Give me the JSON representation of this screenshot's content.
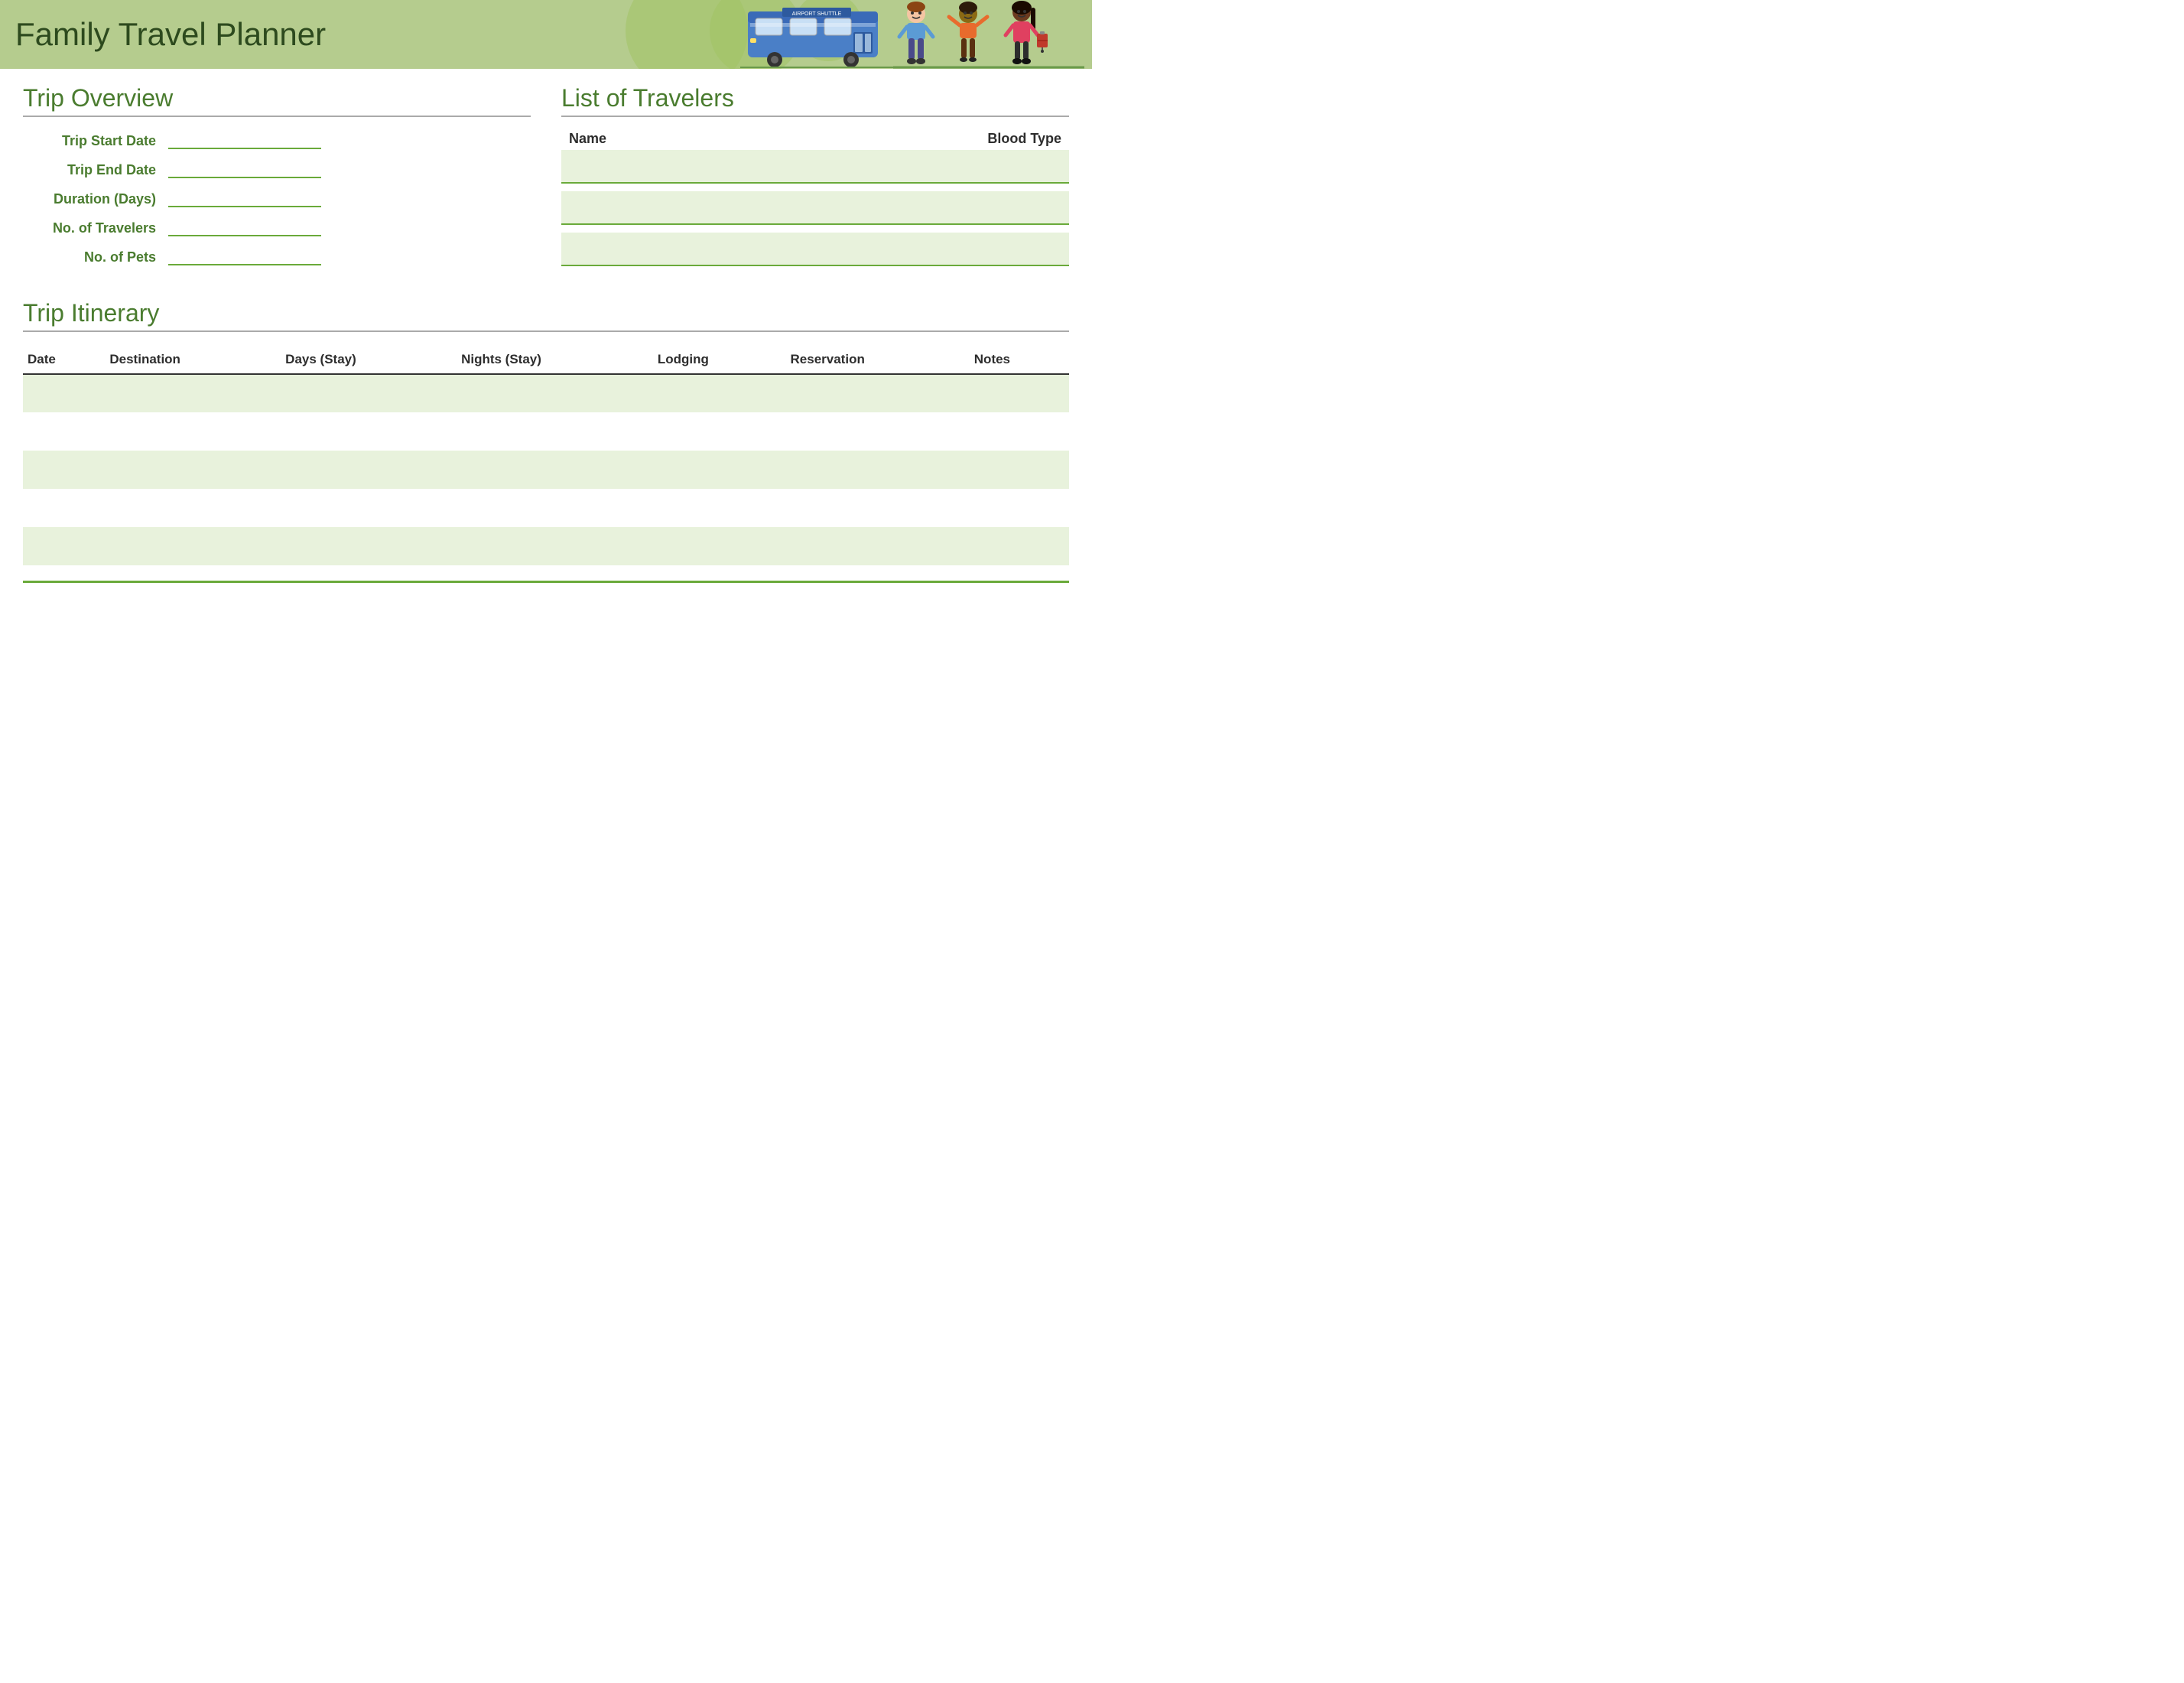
{
  "header": {
    "title": "Family Travel Planner"
  },
  "trip_overview": {
    "section_title": "Trip Overview",
    "fields": [
      {
        "label": "Trip Start Date",
        "key": "trip_start_date"
      },
      {
        "label": "Trip End Date",
        "key": "trip_end_date"
      },
      {
        "label": "Duration (Days)",
        "key": "duration_days"
      },
      {
        "label": "No. of Travelers",
        "key": "num_travelers"
      },
      {
        "label": "No. of Pets",
        "key": "num_pets"
      }
    ]
  },
  "list_of_travelers": {
    "section_title": "List of Travelers",
    "columns": [
      "Name",
      "Blood Type"
    ],
    "rows": [
      {
        "name": "",
        "blood_type": ""
      },
      {
        "name": "",
        "blood_type": ""
      },
      {
        "name": "",
        "blood_type": ""
      }
    ]
  },
  "trip_itinerary": {
    "section_title": "Trip Itinerary",
    "columns": [
      "Date",
      "Destination",
      "Days (Stay)",
      "Nights (Stay)",
      "Lodging",
      "Reservation",
      "Notes"
    ],
    "rows": [
      {
        "date": "",
        "destination": "",
        "days": "",
        "nights": "",
        "lodging": "",
        "reservation": "",
        "notes": ""
      },
      {
        "date": "",
        "destination": "",
        "days": "",
        "nights": "",
        "lodging": "",
        "reservation": "",
        "notes": ""
      },
      {
        "date": "",
        "destination": "",
        "days": "",
        "nights": "",
        "lodging": "",
        "reservation": "",
        "notes": ""
      },
      {
        "date": "",
        "destination": "",
        "days": "",
        "nights": "",
        "lodging": "",
        "reservation": "",
        "notes": ""
      },
      {
        "date": "",
        "destination": "",
        "days": "",
        "nights": "",
        "lodging": "",
        "reservation": "",
        "notes": ""
      }
    ]
  }
}
